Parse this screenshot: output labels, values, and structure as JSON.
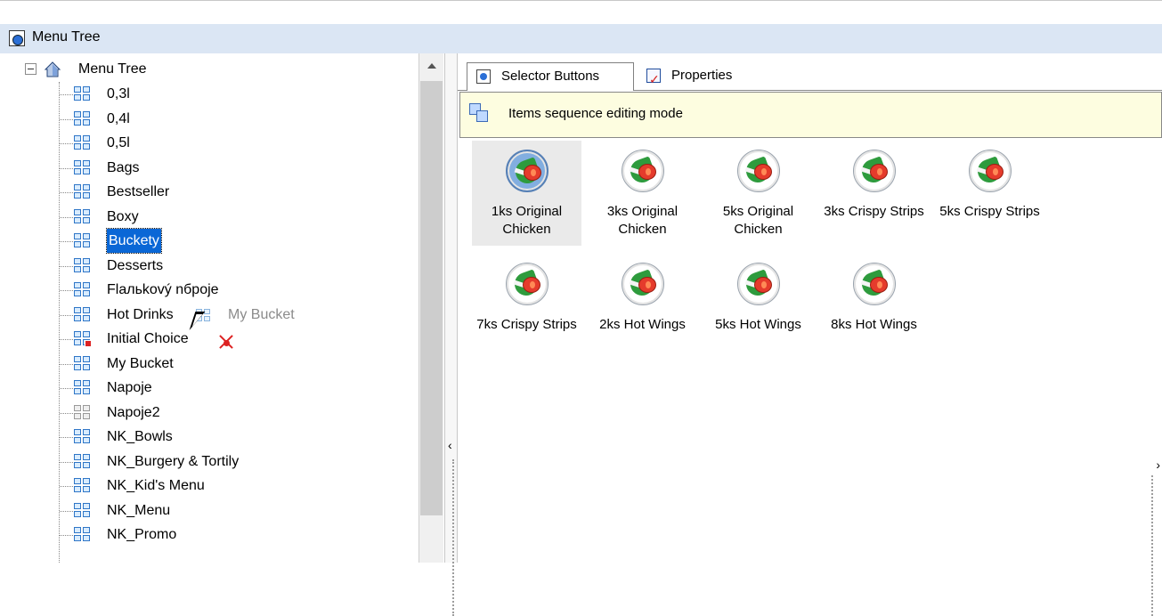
{
  "window": {
    "title": "Menu Tree"
  },
  "tree": {
    "root_label": "Menu Tree",
    "items": [
      {
        "label": "0,3l",
        "icon": "grid-icon"
      },
      {
        "label": "0,4l",
        "icon": "grid-icon"
      },
      {
        "label": "0,5l",
        "icon": "grid-icon"
      },
      {
        "label": "Bags",
        "icon": "grid-icon"
      },
      {
        "label": "Bestseller",
        "icon": "grid-icon"
      },
      {
        "label": "Boxy",
        "icon": "grid-icon"
      },
      {
        "label": "Buckety",
        "icon": "grid-icon",
        "selected": true
      },
      {
        "label": "Desserts",
        "icon": "grid-icon"
      },
      {
        "label": "Flaльkový nбрoje",
        "icon": "grid-icon"
      },
      {
        "label": "Hot Drinks",
        "icon": "grid-icon"
      },
      {
        "label": "Initial Choice",
        "icon": "grid-icon-red-marker"
      },
      {
        "label": "My Bucket",
        "icon": "grid-icon"
      },
      {
        "label": "Napoje",
        "icon": "grid-icon"
      },
      {
        "label": "Napoje2",
        "icon": "grid-icon-gray"
      },
      {
        "label": "NK_Bowls",
        "icon": "grid-icon"
      },
      {
        "label": "NK_Burgery & Tortily",
        "icon": "grid-icon"
      },
      {
        "label": "NK_Kid's Menu",
        "icon": "grid-icon"
      },
      {
        "label": "NK_Menu",
        "icon": "grid-icon"
      },
      {
        "label": "NK_Promo",
        "icon": "grid-icon"
      }
    ]
  },
  "drag": {
    "ghost_label": "My Bucket"
  },
  "tabs": [
    {
      "label": "Selector Buttons",
      "active": true
    },
    {
      "label": "Properties",
      "active": false
    }
  ],
  "notice": {
    "text": "Items sequence editing mode"
  },
  "selector_buttons": [
    {
      "label": "1ks Original Chicken",
      "highlighted": true
    },
    {
      "label": "3ks Original Chicken"
    },
    {
      "label": "5ks Original Chicken"
    },
    {
      "label": "3ks Crispy Strips"
    },
    {
      "label": "5ks Crispy Strips"
    },
    {
      "label": "7ks Crispy Strips"
    },
    {
      "label": "2ks Hot Wings"
    },
    {
      "label": "5ks Hot Wings"
    },
    {
      "label": "8ks Hot Wings"
    }
  ],
  "colors": {
    "title_bar": "#dbe6f4",
    "selection": "#0a67d6",
    "notice_background": "#fdfde0"
  }
}
